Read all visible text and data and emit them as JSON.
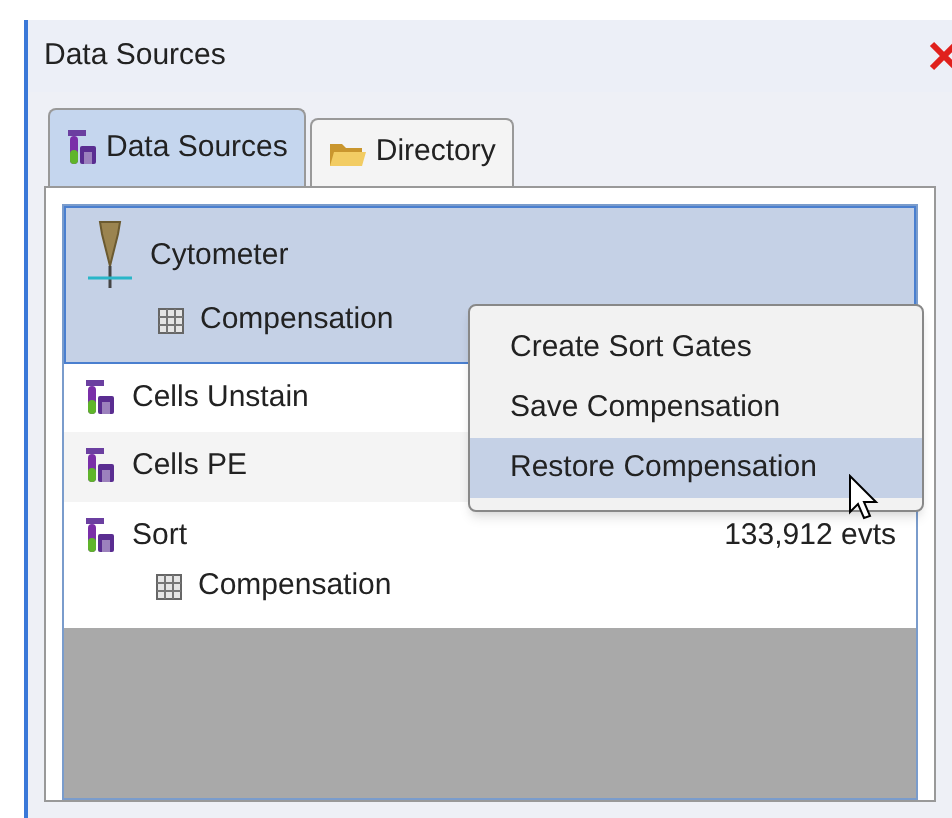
{
  "window": {
    "title": "Data Sources"
  },
  "tabs": [
    {
      "label": "Data Sources",
      "kind": "tube",
      "selected": true
    },
    {
      "label": "Directory",
      "kind": "folder",
      "selected": false
    }
  ],
  "sources": [
    {
      "label": "Cytometer",
      "kind": "cytometer",
      "selected": true,
      "children": [
        {
          "label": "Compensation"
        }
      ]
    },
    {
      "label": "Cells Unstain",
      "kind": "tube",
      "selected": false
    },
    {
      "label": "Cells PE",
      "kind": "tube",
      "selected": false
    },
    {
      "label": "Sort",
      "kind": "tube",
      "selected": false,
      "count": "133,912 evts",
      "children": [
        {
          "label": "Compensation"
        }
      ]
    }
  ],
  "context_menu": [
    {
      "label": "Create Sort Gates",
      "selected": false
    },
    {
      "label": "Save Compensation",
      "selected": false
    },
    {
      "label": "Restore Compensation",
      "selected": true
    }
  ]
}
